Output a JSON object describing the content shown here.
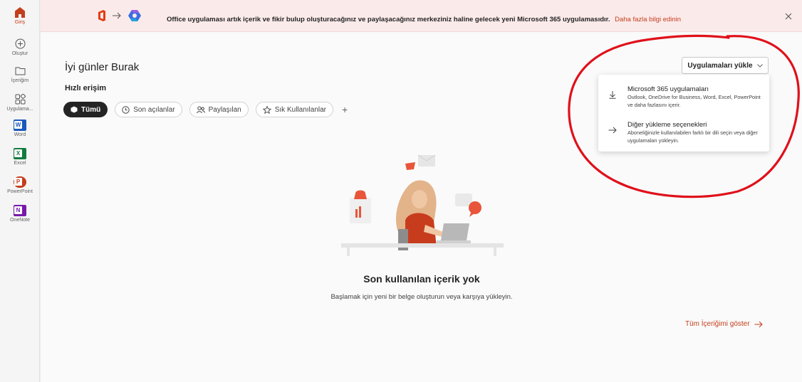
{
  "rail": {
    "items": [
      {
        "label": "Giriş",
        "icon": "home-icon"
      },
      {
        "label": "Oluştur",
        "icon": "plus-circle-icon"
      },
      {
        "label": "İçeriğim",
        "icon": "folder-icon"
      },
      {
        "label": "Uygulama...",
        "icon": "apps-icon"
      },
      {
        "label": "Word",
        "icon": "word-icon",
        "letter": "W"
      },
      {
        "label": "Excel",
        "icon": "excel-icon",
        "letter": "X"
      },
      {
        "label": "PowerPoint",
        "icon": "powerpoint-icon",
        "letter": "P"
      },
      {
        "label": "OneNote",
        "icon": "onenote-icon",
        "letter": "N"
      }
    ]
  },
  "banner": {
    "text": "Office uygulaması artık içerik ve fikir bulup oluşturacağınız ve paylaşacağınız merkeziniz haline gelecek yeni Microsoft 365 uygulamasıdır.",
    "link": "Daha fazla bilgi edinin"
  },
  "greeting": "İyi günler Burak",
  "quick_access": {
    "title": "Hızlı erişim",
    "filters": [
      {
        "label": "Tümü",
        "active": true
      },
      {
        "label": "Son açılanlar"
      },
      {
        "label": "Paylaşılan"
      },
      {
        "label": "Sık Kullanılanlar"
      }
    ],
    "add": "+"
  },
  "install": {
    "button_label": "Uygulamaları yükle",
    "items": [
      {
        "title": "Microsoft 365 uygulamaları",
        "description": "Outlook, OneDrive for Business, Word, Excel, PowerPoint ve daha fazlasını içerir.",
        "icon": "download-icon"
      },
      {
        "title": "Diğer yükleme seçenekleri",
        "description": "Aboneliğinizle kullanılabilen farklı bir dili seçin veya diğer uygulamaları yükleyin.",
        "icon": "arrow-right-icon"
      }
    ]
  },
  "empty_state": {
    "title": "Son kullanılan içerik yok",
    "subtitle": "Başlamak için yeni bir belge oluşturun veya karşıya yükleyin."
  },
  "show_all": "Tüm İçeriğimi göster",
  "colors": {
    "accent": "#c43e1c",
    "word": "#185abd",
    "excel": "#107c41",
    "powerpoint": "#c43e1c",
    "onenote": "#7719aa",
    "annotation": "#e0101a"
  }
}
